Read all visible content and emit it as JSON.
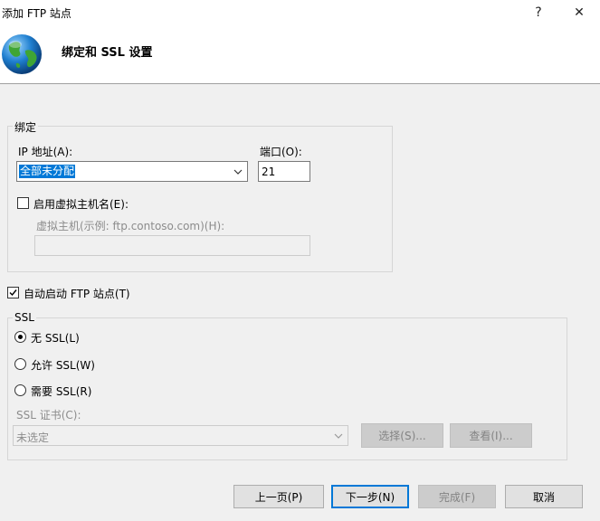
{
  "window": {
    "title": "添加 FTP 站点",
    "help_glyph": "?",
    "close_glyph": "✕"
  },
  "header": {
    "title": "绑定和 SSL 设置",
    "icon": "globe-icon"
  },
  "binding": {
    "legend": "绑定",
    "ip_label": "IP 地址(A):",
    "ip_value": "全部未分配",
    "port_label": "端口(O):",
    "port_value": "21",
    "enable_vhost_label": "启用虚拟主机名(E):",
    "enable_vhost_checked": false,
    "vhost_label": "虚拟主机(示例: ftp.contoso.com)(H):",
    "vhost_value": ""
  },
  "autostart": {
    "label": "自动启动 FTP 站点(T)",
    "checked": true
  },
  "ssl": {
    "legend": "SSL",
    "options": [
      {
        "label": "无 SSL(L)",
        "selected": true
      },
      {
        "label": "允许 SSL(W)",
        "selected": false
      },
      {
        "label": "需要 SSL(R)",
        "selected": false
      }
    ],
    "cert_label": "SSL 证书(C):",
    "cert_value": "未选定",
    "select_button": "选择(S)...",
    "view_button": "查看(I)..."
  },
  "footer": {
    "prev": "上一页(P)",
    "next": "下一步(N)",
    "finish": "完成(F)",
    "cancel": "取消"
  },
  "colors": {
    "selection": "#0078d7",
    "disabled_text": "#8c8c8c",
    "background": "#f0f0f0"
  }
}
